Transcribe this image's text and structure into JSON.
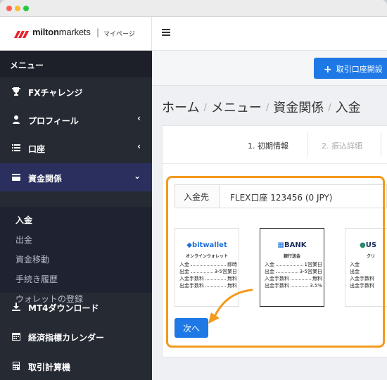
{
  "brand": {
    "name_bold": "milton",
    "name_rest": "markets",
    "separator": "|",
    "mypage": "マイページ"
  },
  "sidebar": {
    "menu_header": "メニュー",
    "items": [
      {
        "label": "FXチャレンジ",
        "icon": "trophy-icon",
        "chevron": ""
      },
      {
        "label": "プロフィール",
        "icon": "user-icon",
        "chevron": "‹"
      },
      {
        "label": "口座",
        "icon": "list-icon",
        "chevron": "‹"
      },
      {
        "label": "資金関係",
        "icon": "wallet-icon",
        "chevron": "⌄"
      },
      {
        "label": "MT4ダウンロード",
        "icon": "download-icon",
        "chevron": ""
      },
      {
        "label": "経済指標カレンダー",
        "icon": "calendar-icon",
        "chevron": ""
      },
      {
        "label": "取引計算機",
        "icon": "calculator-icon",
        "chevron": ""
      }
    ],
    "submenu": [
      "入金",
      "出金",
      "資金移動",
      "手続き履歴",
      "ウォレットの登録"
    ]
  },
  "actionbar": {
    "open_account_label": "取引口座開設"
  },
  "breadcrumb": [
    "ホーム",
    "メニュー",
    "資金関係",
    "入金"
  ],
  "steps": {
    "step1": "1. 初期情報",
    "step2": "2. 振込詳細"
  },
  "destination": {
    "label": "入金先",
    "value": "FLEX口座 123456 (0 JPY)"
  },
  "cards": [
    {
      "logo": "bitwallet",
      "sub": "オンラインウォレット",
      "rows": [
        {
          "k": "入金",
          "v": "即時"
        },
        {
          "k": "出金",
          "v": "3-5営業日"
        },
        {
          "k": "入金手数料",
          "v": "無料"
        },
        {
          "k": "出金手数料",
          "v": "無料"
        }
      ]
    },
    {
      "logo": "BANK",
      "sub": "銀行送金",
      "rows": [
        {
          "k": "入金",
          "v": "1営業日"
        },
        {
          "k": "出金",
          "v": "3-5営業日"
        },
        {
          "k": "入金手数料",
          "v": "無料"
        },
        {
          "k": "出金手数料",
          "v": "3.5%"
        }
      ]
    },
    {
      "logo": "US",
      "sub": "クリ",
      "rows": [
        {
          "k": "入金",
          "v": ""
        },
        {
          "k": "出金",
          "v": ""
        },
        {
          "k": "入金手数料",
          "v": ""
        },
        {
          "k": "出金手数料",
          "v": ""
        }
      ]
    }
  ],
  "next_label": "次へ",
  "colors": {
    "accent": "#1e78e6",
    "highlight": "#f39a1f",
    "sidebar": "#262a33",
    "brand_red": "#e8222b"
  }
}
